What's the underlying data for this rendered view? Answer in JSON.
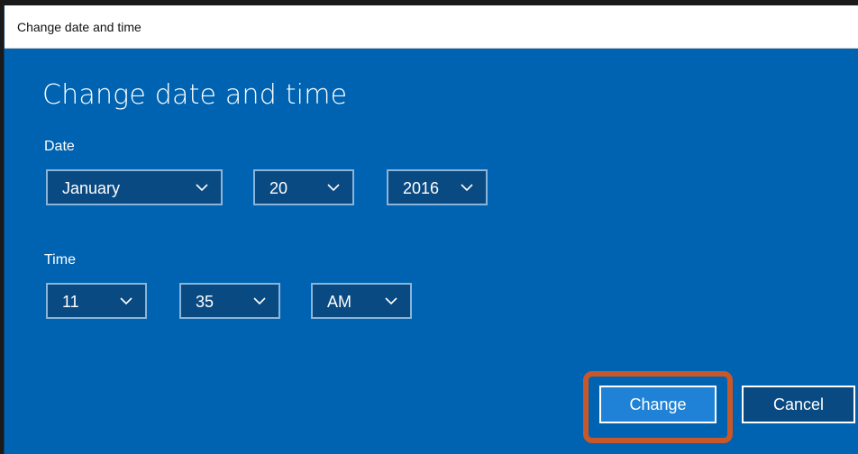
{
  "window": {
    "title": "Change date and time"
  },
  "heading": "Change date and time",
  "date": {
    "label": "Date",
    "month": "January",
    "day": "20",
    "year": "2016"
  },
  "time": {
    "label": "Time",
    "hour": "11",
    "minute": "35",
    "period": "AM"
  },
  "buttons": {
    "change": "Change",
    "cancel": "Cancel"
  },
  "colors": {
    "background": "#0063b1",
    "highlight": "#c8572a"
  },
  "icons": {
    "dropdown": "chevron-down-icon"
  }
}
